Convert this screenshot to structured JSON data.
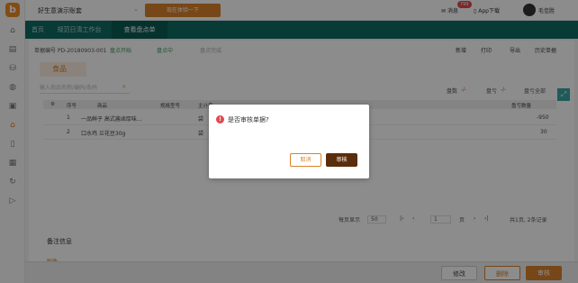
{
  "app": {
    "logo": "b"
  },
  "sidebar": {
    "icons": [
      "home-icon",
      "doc-icon",
      "cart-icon",
      "bag-icon",
      "box-icon",
      "store-icon",
      "clipboard-icon",
      "report-icon",
      "refresh-icon",
      "play-icon"
    ]
  },
  "topbar": {
    "shop_name": "好生意演示账套",
    "trial_label": "现在体验一下",
    "message_label": "消息",
    "message_badge": "799",
    "app_download": "App下载",
    "user_name": "毛佳胜"
  },
  "tabs": [
    {
      "label": "首页"
    },
    {
      "label": "规范日清工作台"
    },
    {
      "label": "查看盘点单"
    }
  ],
  "doc": {
    "number_label": "单据编号",
    "number": "PD-20180903-001",
    "steps": [
      "盘点开始",
      "盘点中",
      "盘点完成"
    ]
  },
  "toolbar": [
    "新增",
    "打印",
    "导出",
    "历史单据"
  ],
  "category": "食品",
  "search": {
    "placeholder": "输入商品名称/编码/条码"
  },
  "counters": {
    "left_label": "盘数",
    "left_value": "-/-",
    "mid_label": "盘亏",
    "mid_value": "-/-",
    "right_label": "盘亏全部"
  },
  "table": {
    "headers": [
      "序号",
      "商品",
      "规格型号",
      "主计量",
      "盈亏数量"
    ],
    "rows": [
      {
        "no": "1",
        "name": "一品鲜子 高式酱卤厚味...",
        "unit": "袋",
        "diff": "-950"
      },
      {
        "no": "2",
        "name": "口水鸡 兰花豆30g",
        "unit": "袋",
        "diff": "30"
      }
    ]
  },
  "pager": {
    "page_size_label": "每页显示",
    "page_size": "50",
    "page": "1",
    "page_suffix": "页",
    "summary": "共1页, 2条记录"
  },
  "remark": {
    "title": "备注信息",
    "attach": "附件"
  },
  "bottom": {
    "edit": "修改",
    "delete": "删除",
    "audit": "审核"
  },
  "dialog": {
    "message": "是否审核单据?",
    "cancel": "取消",
    "confirm": "审核"
  },
  "colors": {
    "accent": "#d9822b",
    "teal": "#106b63",
    "danger": "#e5474e"
  }
}
